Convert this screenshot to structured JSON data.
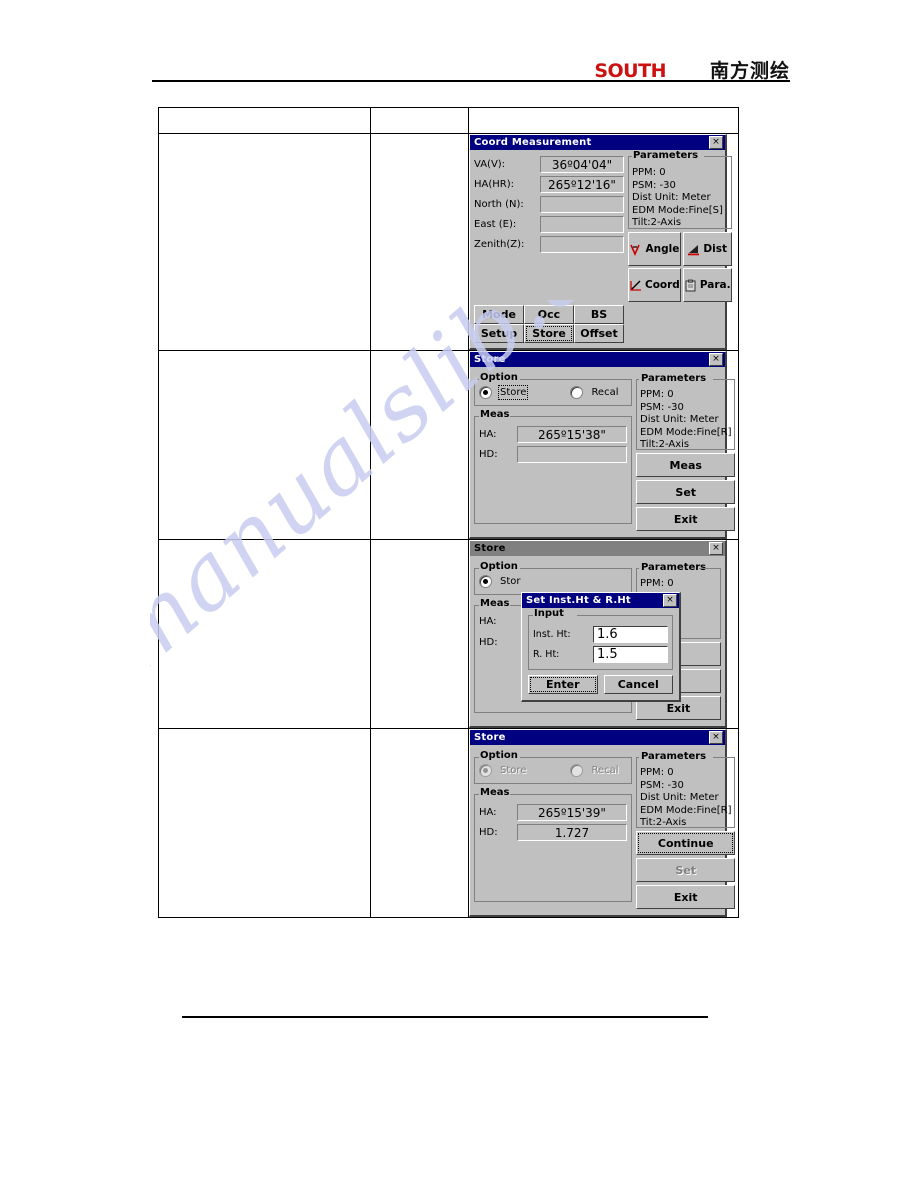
{
  "header": {
    "brand_latin": "SOUTH",
    "brand_cjk": "南方测绘"
  },
  "table": {
    "columns": [
      "",
      "",
      ""
    ],
    "rows": [
      {
        "col_a": "",
        "col_b": "",
        "screenshot": "coord-measurement"
      },
      {
        "col_a": "",
        "col_b": "",
        "screenshot": "store-meas"
      },
      {
        "col_a": "",
        "col_b": "",
        "screenshot": "store-set-heights"
      },
      {
        "col_a": "",
        "col_b": "",
        "screenshot": "store-continue"
      }
    ]
  },
  "watermark": {
    "text": "manualslib.com"
  },
  "dialog_coord": {
    "title": "Coord Measurement",
    "close_label": "×",
    "fields": [
      {
        "label": "VA(V):",
        "value": "36º04'04\""
      },
      {
        "label": "HA(HR):",
        "value": "265º12'16\""
      },
      {
        "label": "North (N):",
        "value": ""
      },
      {
        "label": "East (E):",
        "value": ""
      },
      {
        "label": "Zenith(Z):",
        "value": ""
      }
    ],
    "params_label": "Parameters",
    "params": [
      "PPM:  0",
      "PSM: -30",
      "Dist Unit: Meter",
      "EDM Mode:Fine[S]",
      "Tilt:2-Axis"
    ],
    "softkeys": [
      {
        "label": "Mode",
        "focus": false
      },
      {
        "label": "Occ",
        "focus": false
      },
      {
        "label": "BS",
        "focus": false
      },
      {
        "label": "Setup",
        "focus": false
      },
      {
        "label": "Store",
        "focus": true
      },
      {
        "label": "Offset",
        "focus": false
      }
    ],
    "icon_buttons": [
      {
        "label": "Angle",
        "icon": "angle-icon"
      },
      {
        "label": "Dist",
        "icon": "distance-icon"
      },
      {
        "label": "Coord",
        "icon": "coordinate-icon"
      },
      {
        "label": "Para.",
        "icon": "parameter-icon"
      }
    ]
  },
  "dialog_store_meas": {
    "title": "Store",
    "close_label": "×",
    "option_label": "Option",
    "options": [
      {
        "label": "Store",
        "selected": true
      },
      {
        "label": "Recal",
        "selected": false
      }
    ],
    "meas_label": "Meas",
    "fields": [
      {
        "label": "HA:",
        "value": "265º15'38\""
      },
      {
        "label": "HD:",
        "value": ""
      }
    ],
    "params_label": "Parameters",
    "params": [
      "PPM:  0",
      "PSM: -30",
      "Dist Unit: Meter",
      "EDM Mode:Fine[R]",
      "Tilt:2-Axis"
    ],
    "buttons": [
      {
        "label": "Meas",
        "disabled": false
      },
      {
        "label": "Set",
        "disabled": false
      },
      {
        "label": "Exit",
        "disabled": false
      }
    ]
  },
  "dialog_store_heights": {
    "title": "Store",
    "close_label": "×",
    "option_label": "Option",
    "options": [
      {
        "label": "Stor",
        "selected": true
      }
    ],
    "meas_label": "Meas",
    "fields": [
      {
        "label": "HA:",
        "value": ""
      },
      {
        "label": "HD:",
        "value": ""
      }
    ],
    "params_label": "Parameters",
    "params": [
      "PPM:  0",
      "Meter",
      ":Fine[R]"
    ],
    "buttons": [
      {
        "label": "as",
        "disabled": false
      },
      {
        "label": "t",
        "disabled": false
      },
      {
        "label": "Exit",
        "disabled": false
      }
    ],
    "popup": {
      "title": "Set Inst.Ht & R.Ht",
      "close_label": "×",
      "input_label": "Input",
      "inputs": [
        {
          "label": "Inst. Ht:",
          "value": "1.6"
        },
        {
          "label": "R. Ht:",
          "value": "1.5"
        }
      ],
      "buttons": [
        {
          "label": "Enter",
          "focus": true
        },
        {
          "label": "Cancel",
          "focus": false
        }
      ]
    }
  },
  "dialog_store_continue": {
    "title": "Store",
    "close_label": "×",
    "option_label": "Option",
    "options": [
      {
        "label": "Store",
        "selected": true
      },
      {
        "label": "Recal",
        "selected": false
      }
    ],
    "meas_label": "Meas",
    "fields": [
      {
        "label": "HA:",
        "value": "265º15'39\""
      },
      {
        "label": "HD:",
        "value": "1.727"
      }
    ],
    "params_label": "Parameters",
    "params": [
      "PPM:  0",
      "PSM: -30",
      "Dist Unit: Meter",
      "EDM Mode:Fine[R]",
      "Tit:2-Axis"
    ],
    "buttons": [
      {
        "label": "Continue",
        "disabled": false,
        "focus": true
      },
      {
        "label": "Set",
        "disabled": true,
        "focus": false
      },
      {
        "label": "Exit",
        "disabled": false,
        "focus": false
      }
    ]
  },
  "colors": {
    "titlebar_active": "#000080",
    "titlebar_inactive": "#808080",
    "dialog_face": "#c0c0c0",
    "brand_red": "#cc1111",
    "watermark": "#c8cdf0"
  }
}
